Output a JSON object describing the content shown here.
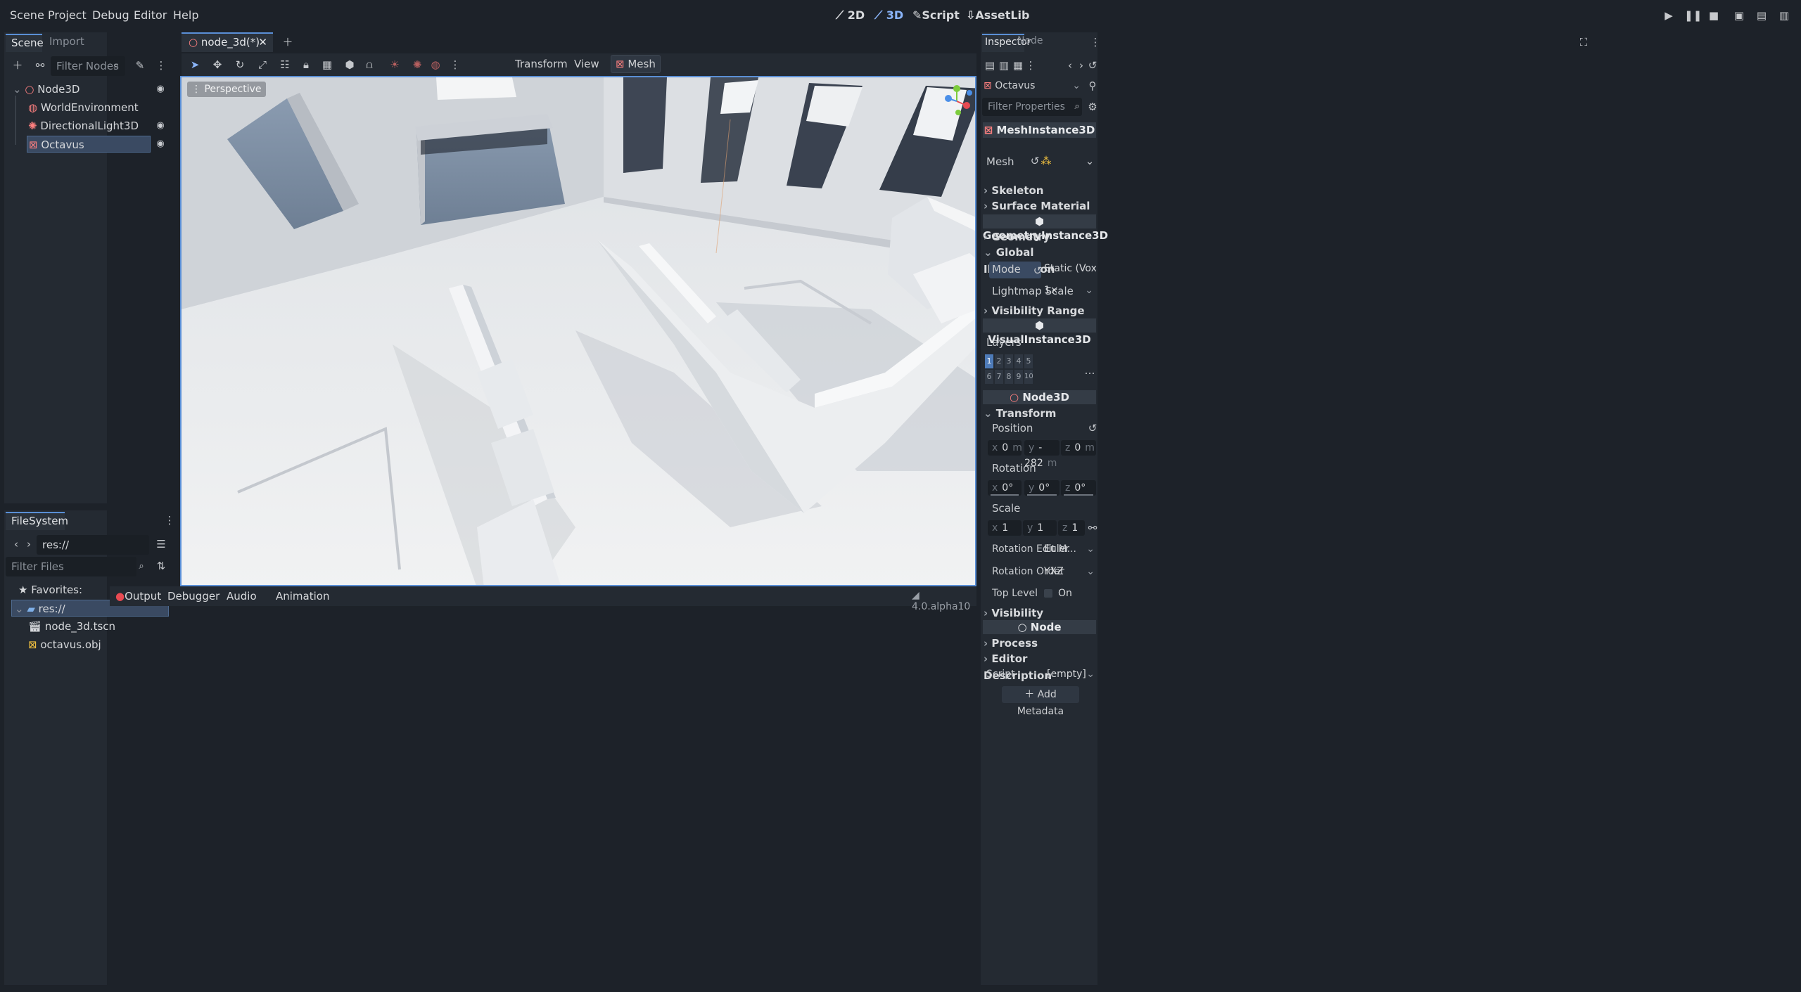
{
  "menu": {
    "items": [
      "Scene",
      "Project",
      "Debug",
      "Editor",
      "Help"
    ]
  },
  "modes": {
    "m2d": "2D",
    "m3d": "3D",
    "script": "Script",
    "assetlib": "AssetLib"
  },
  "scene_dock": {
    "tab_scene": "Scene",
    "tab_import": "Import",
    "filter_placeholder": "Filter Nodes",
    "nodes": [
      {
        "name": "Node3D"
      },
      {
        "name": "WorldEnvironment"
      },
      {
        "name": "DirectionalLight3D"
      },
      {
        "name": "Octavus"
      }
    ]
  },
  "filesystem": {
    "tab": "FileSystem",
    "path": "res://",
    "filter_placeholder": "Filter Files",
    "favorites": "Favorites:",
    "root": "res://",
    "files": [
      "node_3d.tscn",
      "octavus.obj"
    ]
  },
  "editor": {
    "tab_label": "node_3d(*)",
    "transform": "Transform",
    "view": "View",
    "mesh": "Mesh",
    "perspective": "Perspective"
  },
  "bottom": {
    "output": "Output",
    "debugger": "Debugger",
    "audio": "Audio",
    "animation": "Animation",
    "version": "4.0.alpha10"
  },
  "inspector": {
    "tab_inspector": "Inspector",
    "tab_node": "Node",
    "object": "Octavus",
    "filter_placeholder": "Filter Properties",
    "class_meshinstance": "MeshInstance3D",
    "mesh_label": "Mesh",
    "skeleton": "Skeleton",
    "surface_override": "Surface Material Override",
    "class_geometry": "GeometryInstance3D",
    "geometry": "Geometry",
    "global_illumination": "Global Illumination",
    "mode_label": "Mode",
    "mode_value": "Static (VoxelGI/S",
    "lightmap_label": "Lightmap Scale",
    "lightmap_value": "1×",
    "visibility_range": "Visibility Range",
    "class_visual": "VisualInstance3D",
    "layers": "Layers",
    "layer_nums": [
      "1",
      "2",
      "3",
      "4",
      "5",
      "6",
      "7",
      "8",
      "9",
      "10"
    ],
    "class_node3d": "Node3D",
    "transform": "Transform",
    "position": "Position",
    "pos": {
      "x": "0",
      "y": "-282",
      "z": "0",
      "unit": "m"
    },
    "rotation": "Rotation",
    "rot": {
      "x": "0",
      "y": "0",
      "z": "0",
      "unit": "°"
    },
    "scale": "Scale",
    "scl": {
      "x": "1",
      "y": "1",
      "z": "1"
    },
    "rot_edit_label": "Rotation Edit M...",
    "rot_edit_value": "Euler",
    "rot_order_label": "Rotation Order",
    "rot_order_value": "YXZ",
    "top_level_label": "Top Level",
    "top_level_value": "On",
    "visibility": "Visibility",
    "class_node": "Node",
    "process": "Process",
    "editor_desc": "Editor Description",
    "script_label": "Script",
    "script_value": "[empty]",
    "add_metadata": "Add Metadata"
  },
  "colors": {
    "accent": "#5a8fd6",
    "selection": "#3a4a62",
    "node3d_red": "#fc7f7f",
    "viewport_sky": "#e9ecef"
  }
}
